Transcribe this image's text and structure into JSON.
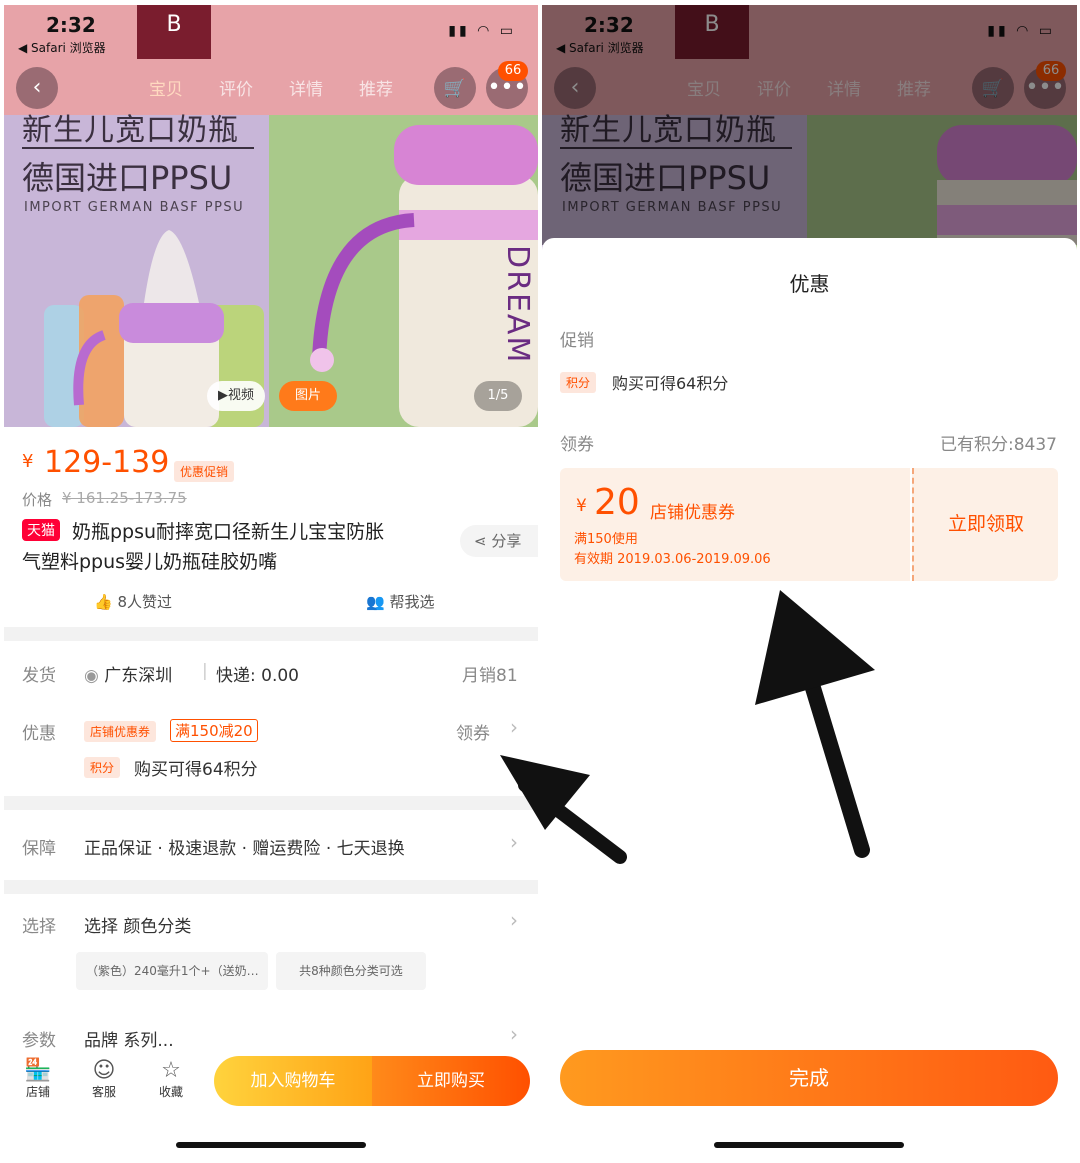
{
  "status": {
    "time": "2:32",
    "back_app": "◀ Safari 浏览器"
  },
  "nav": {
    "tabs": [
      "宝贝",
      "评价",
      "详情",
      "推荐"
    ],
    "badge": "66"
  },
  "hero": {
    "title1": "新生儿宽口奶瓶",
    "title2": "德国进口PPSU",
    "subtitle": "IMPORT GERMAN BASF PPSU",
    "brand_text": "DREAM",
    "video_label": "▶视频",
    "image_label": "图片",
    "page_counter": "1/5"
  },
  "product": {
    "currency": "¥",
    "price": "129-139",
    "promo_tag": "优惠促销",
    "orig_price_label": "价格",
    "orig_price": "¥ 161.25-173.75",
    "tmall_tag": "天猫",
    "title_line1": "奶瓶ppsu耐摔宽口径新生儿宝宝防胀",
    "title_line2": "气塑料ppus婴儿奶瓶硅胶奶嘴",
    "share_label": "分享",
    "likes": "8人赞过",
    "help_choose": "帮我选"
  },
  "shipping": {
    "label": "发货",
    "location": "广东深圳",
    "fee": "快递: 0.00",
    "monthly_sales": "月销81"
  },
  "discount": {
    "label": "优惠",
    "shop_coupon_tag": "店铺优惠券",
    "coupon_value": "满150减20",
    "get_coupon": "领券",
    "points_tag": "积分",
    "points_text": "购买可得64积分"
  },
  "guarantee": {
    "label": "保障",
    "text": "正品保证 · 极速退款 · 赠运费险 · 七天退换"
  },
  "select": {
    "label": "选择",
    "text": "选择 颜色分类",
    "option1": "（紫色）240毫升1个+（送奶…",
    "option2": "共8种颜色分类可选"
  },
  "params": {
    "label": "参数",
    "text": "品牌 系列..."
  },
  "bottom": {
    "shop": "店铺",
    "service": "客服",
    "favorite": "收藏",
    "add_cart": "加入购物车",
    "buy_now": "立即购买"
  },
  "sheet": {
    "title": "优惠",
    "promo_label": "促销",
    "points_tag": "积分",
    "points_text": "购买可得64积分",
    "coupon_label": "领券",
    "existing_points": "已有积分:8437",
    "coupon_currency": "¥",
    "coupon_amount": "20",
    "coupon_name": "店铺优惠券",
    "coupon_condition": "满150使用",
    "coupon_validity": "有效期 2019.03.06-2019.09.06",
    "claim_button": "立即领取",
    "done_button": "完成"
  },
  "colors": {
    "accent": "#ff5000",
    "coupon_bg": "#fdf0e6"
  }
}
